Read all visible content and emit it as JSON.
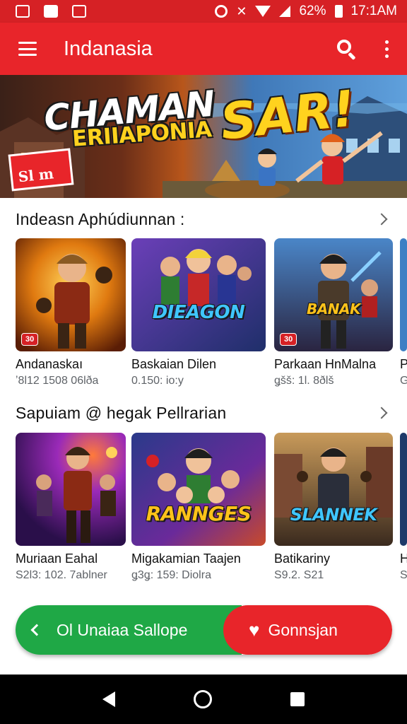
{
  "status_bar": {
    "battery": "62%",
    "time": "17:1AM"
  },
  "app_bar": {
    "title": "Indanasia",
    "search_icon": "search-icon",
    "more_icon": "more-vert-icon",
    "menu_icon": "menu-icon"
  },
  "banner": {
    "title_main": "CHAMAN",
    "title_accent": "SAR!",
    "subtitle": "ERIIAPONIA",
    "sign_line1": "",
    "sign_line2": "Sl m"
  },
  "sections": [
    {
      "title": "Indeasn Aphúdiunnan :",
      "cards": [
        {
          "title": "Andanaskaı",
          "meta": "ʼ8l12 1508 06lða",
          "badge": "30",
          "logo": ""
        },
        {
          "title": "Baskaian Dilen",
          "meta": "0.150: io:y",
          "badge": "",
          "logo": "DIEAGON"
        },
        {
          "title": "Parkaan HnMalna",
          "meta": "ǥšš: 1l. 8ðlš",
          "badge": "30",
          "logo": "BANAK"
        },
        {
          "title": "P",
          "meta": "G",
          "badge": "",
          "logo": ""
        }
      ]
    },
    {
      "title": "Sapuiam @ hegak Pellrarian",
      "cards": [
        {
          "title": "Muriaan Eahal",
          "meta": "S2l3: 102. 7ablner",
          "badge": "",
          "logo": ""
        },
        {
          "title": "Migakamian Taajen",
          "meta": "ǥ3ǥ: 159: Diolra",
          "badge": "",
          "logo": "RANNGES"
        },
        {
          "title": "Batikariny",
          "meta": "S9.2. S21",
          "badge": "",
          "logo": "SLANNEK"
        },
        {
          "title": "H",
          "meta": "S",
          "badge": "",
          "logo": ""
        }
      ]
    }
  ],
  "cta": {
    "left_label": "Ol Unaiaa Sallope",
    "right_label": "Gonnsjan"
  },
  "colors": {
    "primary_red": "#e8252a",
    "status_red": "#d62125",
    "green": "#1fa846",
    "nav_bg": "#000000"
  }
}
